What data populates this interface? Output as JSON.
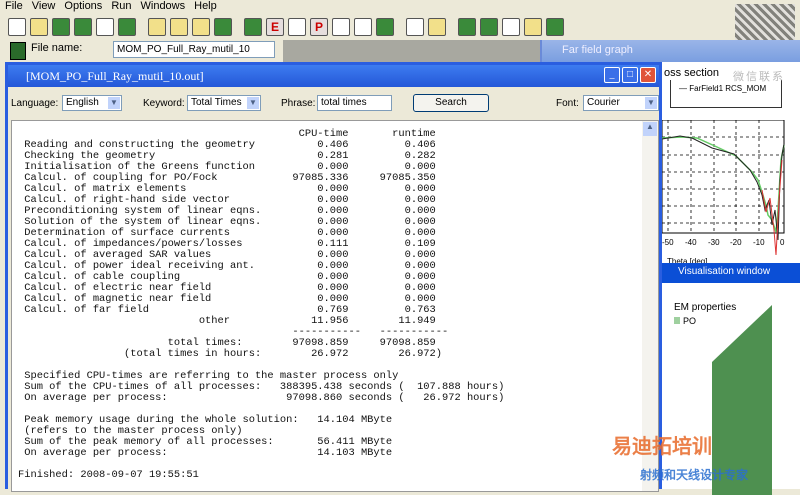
{
  "menu": [
    "File",
    "View",
    "Options",
    "Run",
    "Windows",
    "Help"
  ],
  "file_row": {
    "label": "File name:",
    "value": "MOM_PO_Full_Ray_mutil_10"
  },
  "far_field": {
    "title": "Far field graph",
    "section": "oss section",
    "legend": "FarField1 RCS_MOM",
    "x_ticks": [
      "-50",
      "-40",
      "-30",
      "-20",
      "-10",
      "0"
    ],
    "x_label": "Theta [deg]"
  },
  "visualisation": {
    "title": "Visualisation window",
    "em_properties": "EM properties",
    "po": "PO"
  },
  "output": {
    "title": "[MOM_PO_Full_Ray_mutil_10.out]",
    "language_label": "Language:",
    "language": "English",
    "keyword_label": "Keyword:",
    "keyword": "Total Times",
    "phrase_label": "Phrase:",
    "phrase": "total times",
    "search": "Search",
    "font_label": "Font:",
    "font": "Courier",
    "lines": [
      "                                             CPU-time       runtime",
      " Reading and constructing the geometry          0.406         0.406",
      " Checking the geometry                          0.281         0.282",
      " Initialisation of the Greens function          0.000         0.000",
      " Calcul. of coupling for PO/Fock            97085.336     97085.350",
      " Calcul. of matrix elements                     0.000         0.000",
      " Calcul. of right-hand side vector              0.000         0.000",
      " Preconditioning system of linear eqns.         0.000         0.000",
      " Solution of the system of linear eqns.         0.000         0.000",
      " Determination of surface currents              0.000         0.000",
      " Calcul. of impedances/powers/losses            0.111         0.109",
      " Calcul. of averaged SAR values                 0.000         0.000",
      " Calcul. of power ideal receiving ant.          0.000         0.000",
      " Calcul. of cable coupling                      0.000         0.000",
      " Calcul. of electric near field                 0.000         0.000",
      " Calcul. of magnetic near field                 0.000         0.000",
      " Calcul. of far field                           0.769         0.763",
      "                             other             11.956        11.949",
      "                                            -----------   -----------",
      "                        total times:        97098.859     97098.859",
      "                 (total times in hours:        26.972        26.972)",
      "",
      " Specified CPU-times are referring to the master process only",
      " Sum of the CPU-times of all processes:   388395.438 seconds (  107.888 hours)",
      " On average per process:                   97098.860 seconds (   26.972 hours)",
      "",
      " Peak memory usage during the whole solution:   14.104 MByte",
      " (refers to the master process only)",
      " Sum of the peak memory of all processes:       56.411 MByte",
      " On average per process:                        14.103 MByte",
      "",
      "Finished: 2008-09-07 19:55:51"
    ]
  },
  "watermark": {
    "line1": "易迪拓培训",
    "line2": "射频和天线设计专家",
    "side": "微信联系"
  }
}
